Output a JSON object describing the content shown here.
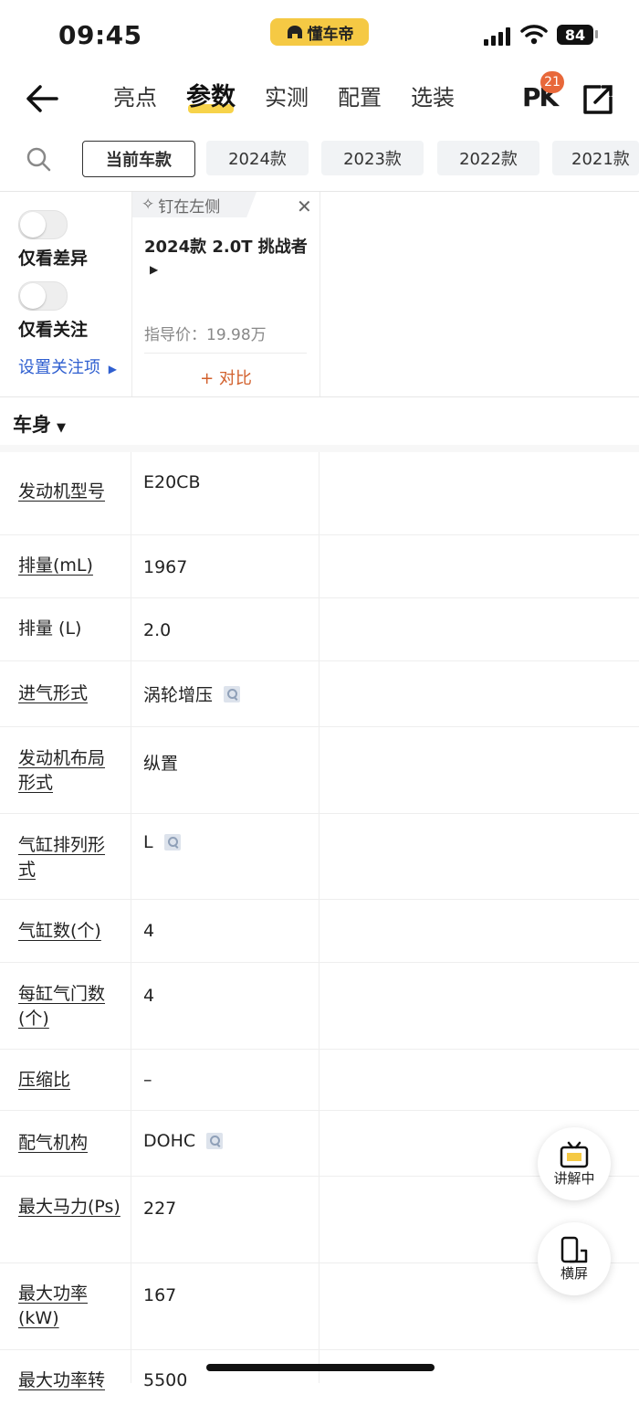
{
  "status": {
    "time": "09:45",
    "app_name": "懂车帝",
    "battery": "84"
  },
  "nav": {
    "tabs": [
      {
        "label": "亮点",
        "active": false
      },
      {
        "label": "参数",
        "active": true
      },
      {
        "label": "实测",
        "active": false
      },
      {
        "label": "配置",
        "active": false
      },
      {
        "label": "选装",
        "active": false
      }
    ],
    "pk_label": "PK",
    "pk_badge": "21"
  },
  "years": [
    "当前车款",
    "2024款",
    "2023款",
    "2022款",
    "2021款"
  ],
  "filters": {
    "only_diff": "仅看差异",
    "only_follow": "仅看关注",
    "set_follow": "设置关注项"
  },
  "car": {
    "pin_label": "钉在左侧",
    "name": "2024款 2.0T 挑战者",
    "price": "指导价：19.98万",
    "compare": "+ 对比"
  },
  "section": {
    "title": "车身"
  },
  "rows": [
    {
      "label": "发动机型号",
      "value": "E20CB",
      "underline": true,
      "mag": false
    },
    {
      "label": "排量(mL)",
      "value": "1967",
      "underline": true,
      "mag": false
    },
    {
      "label": "排量 (L)",
      "value": "2.0",
      "underline": false,
      "mag": false
    },
    {
      "label": "进气形式",
      "value": "涡轮增压",
      "underline": true,
      "mag": true
    },
    {
      "label": "发动机布局形式",
      "value": "纵置",
      "underline": true,
      "mag": false
    },
    {
      "label": "气缸排列形式",
      "value": "L",
      "underline": true,
      "mag": true
    },
    {
      "label": "气缸数(个)",
      "value": "4",
      "underline": true,
      "mag": false
    },
    {
      "label": "每缸气门数(个)",
      "value": "4",
      "underline": true,
      "mag": false
    },
    {
      "label": "压缩比",
      "value": "–",
      "underline": true,
      "mag": false
    },
    {
      "label": "配气机构",
      "value": "DOHC",
      "underline": true,
      "mag": true
    },
    {
      "label": "最大马力(Ps)",
      "value": "227",
      "underline": true,
      "mag": false
    },
    {
      "label": "最大功率(kW)",
      "value": "167",
      "underline": true,
      "mag": false
    },
    {
      "label": "最大功率转",
      "value": "5500",
      "underline": true,
      "mag": false
    }
  ],
  "fabs": {
    "explain": "讲解中",
    "landscape": "横屏"
  }
}
